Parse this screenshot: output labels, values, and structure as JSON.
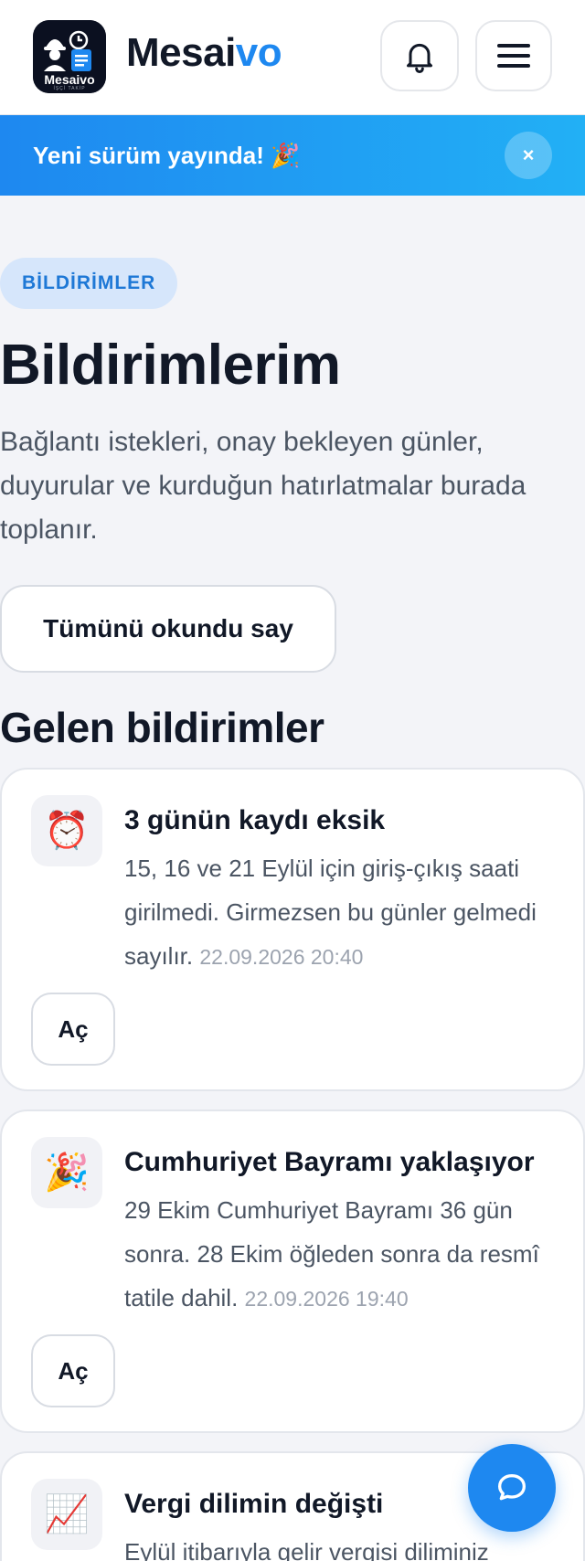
{
  "header": {
    "brand_main": "Mesai",
    "brand_accent": "vo",
    "logo_text": "Mesaivo",
    "logo_subtext": "İŞÇİ TAKİP",
    "colors": {
      "accent": "#1e88f0",
      "logo_bg": "#0b1020"
    },
    "icons": {
      "notifications": "bell-icon",
      "menu": "hamburger-icon"
    }
  },
  "banner": {
    "text": "Yeni sürüm yayında! 🎉",
    "close_label": "×"
  },
  "page": {
    "eyebrow": "BİLDİRİMLER",
    "title": "Bildirimlerim",
    "description": "Bağlantı istekleri, onay bekleyen günler, duyurular ve kurduğun hatırlatmalar burada toplanır.",
    "mark_all_read": "Tümünü okundu say",
    "section_title": "Gelen bildirimler"
  },
  "notifications": [
    {
      "icon": "⏰",
      "icon_name": "alarm-clock-icon",
      "title": "3 günün kaydı eksik",
      "body": "15, 16 ve 21 Eylül için giriş-çıkış saati girilmedi. Girmezsen bu günler gelmedi sayılır.",
      "time": "22.09.2026 20:40",
      "action": "Aç"
    },
    {
      "icon": "🎉",
      "icon_name": "party-popper-icon",
      "title": "Cumhuriyet Bayramı yaklaşıyor",
      "body": "29 Ekim Cumhuriyet Bayramı 36 gün sonra. 28 Ekim öğleden sonra da resmî tatile dahil.",
      "time": "22.09.2026 19:40",
      "action": "Aç"
    },
    {
      "icon": "📈",
      "icon_name": "chart-increasing-icon",
      "title": "Vergi dilimin değişti",
      "body": "Eylül itibarıyla gelir vergisi diliminiz"
    }
  ],
  "fab": {
    "icon_name": "chat-bubble-icon"
  }
}
